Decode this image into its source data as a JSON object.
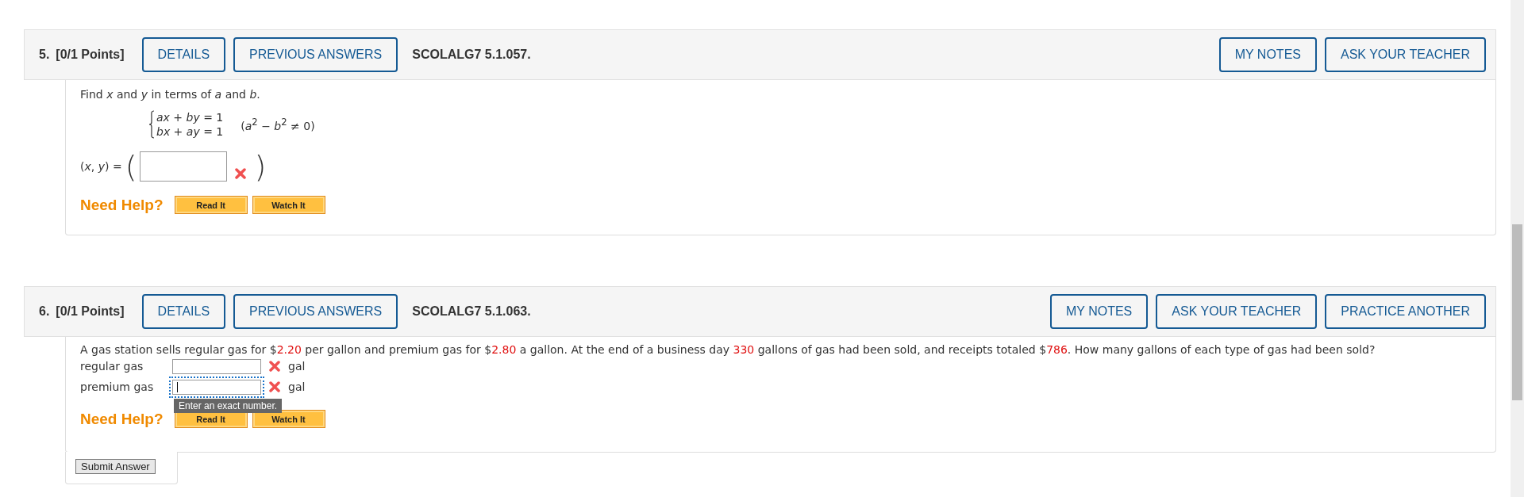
{
  "questions": [
    {
      "kind": "system",
      "number": "5.",
      "points": "[0/1 Points]",
      "left_buttons": [
        "DETAILS",
        "PREVIOUS ANSWERS"
      ],
      "code": "SCOLALG7 5.1.057.",
      "right_buttons": [
        "MY NOTES",
        "ASK YOUR TEACHER"
      ],
      "prompt": "Find *x* and *y* in terms of *a* and *b*.",
      "equations": [
        "*ax* + *by* = 1",
        "*bx* + *ay* = 1"
      ],
      "condition": "(*a*$^{2}$ − *b*$^{2}$ ≠ 0)",
      "answer_label": "(*x*, *y*) =",
      "open_paren": "(",
      "close_paren": ")",
      "answer": {
        "correct": false
      },
      "help_label": "Need Help?",
      "help_buttons": [
        "Read It",
        "Watch It"
      ]
    },
    {
      "kind": "word",
      "number": "6.",
      "points": "[0/1 Points]",
      "left_buttons": [
        "DETAILS",
        "PREVIOUS ANSWERS"
      ],
      "code": "SCOLALG7 5.1.063.",
      "right_buttons": [
        "MY NOTES",
        "ASK YOUR TEACHER",
        "PRACTICE ANOTHER"
      ],
      "prompt_parts": [
        {
          "text": "A gas station sells regular gas for $",
          "highlighted": false
        },
        {
          "text": "2.20",
          "highlighted": true
        },
        {
          "text": " per gallon and premium gas for $",
          "highlighted": false
        },
        {
          "text": "2.80",
          "highlighted": true
        },
        {
          "text": " a gallon. At the end of a business day ",
          "highlighted": false
        },
        {
          "text": "330",
          "highlighted": true
        },
        {
          "text": " gallons of gas had been sold, and receipts totaled $",
          "highlighted": false
        },
        {
          "text": "786",
          "highlighted": true
        },
        {
          "text": ". How many gallons of each type of gas had been sold?",
          "highlighted": false
        }
      ],
      "fields": [
        {
          "label": "regular gas",
          "correct": false,
          "focused": false,
          "unit": "gal"
        },
        {
          "label": "premium gas",
          "correct": false,
          "focused": true,
          "unit": "gal",
          "tooltip": "Enter an exact number."
        }
      ],
      "help_label": "Need Help?",
      "help_buttons": [
        "Read It",
        "Watch It"
      ]
    }
  ],
  "submit_button": "Submit Answer"
}
